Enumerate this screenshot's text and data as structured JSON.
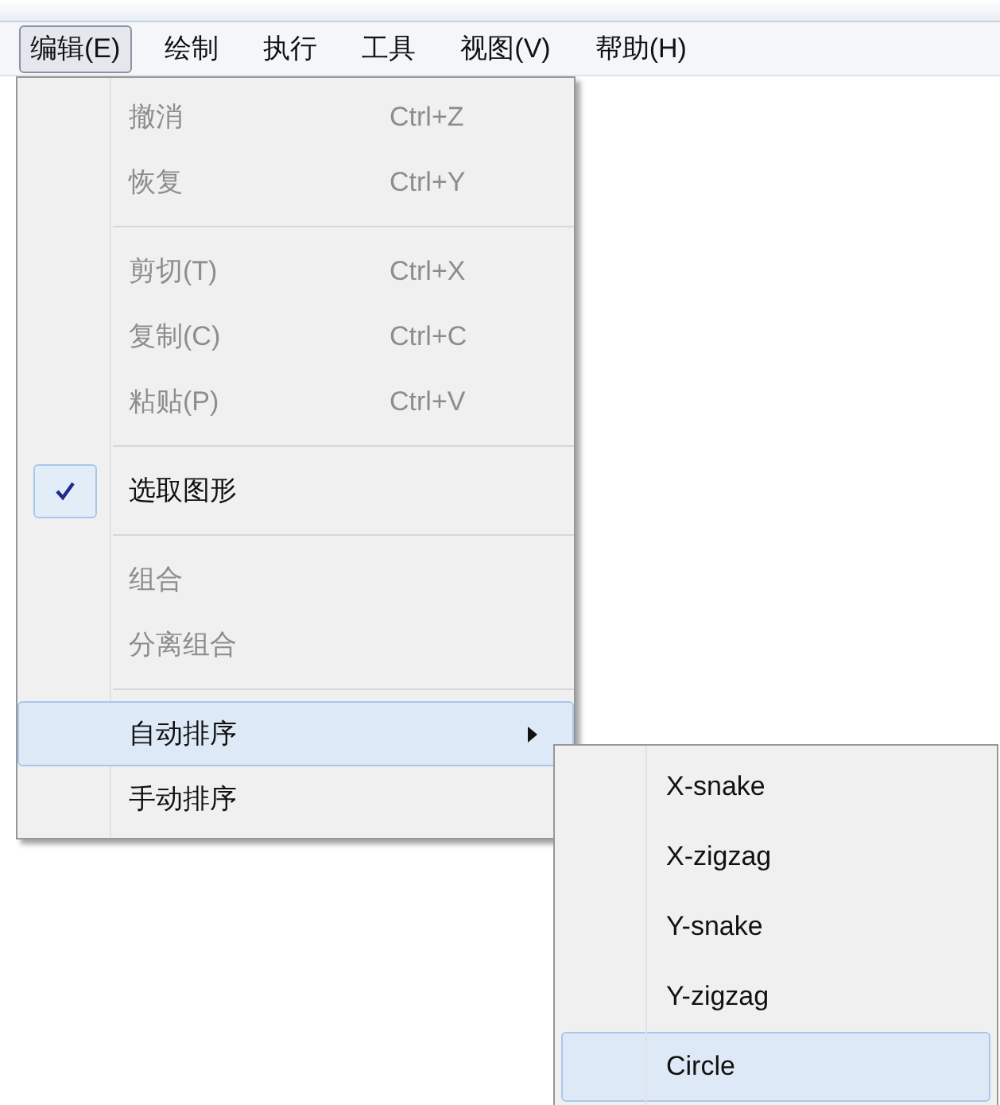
{
  "menubar": [
    {
      "label": "编辑(E)",
      "selected": true
    },
    {
      "label": "绘制",
      "selected": false
    },
    {
      "label": "执行",
      "selected": false
    },
    {
      "label": "工具",
      "selected": false
    },
    {
      "label": "视图(V)",
      "selected": false
    },
    {
      "label": "帮助(H)",
      "selected": false
    }
  ],
  "menu": [
    {
      "kind": "item",
      "label": "撤消",
      "shortcut": "Ctrl+Z",
      "disabled": true,
      "checked": false,
      "selected": false,
      "submenu": false
    },
    {
      "kind": "item",
      "label": "恢复",
      "shortcut": "Ctrl+Y",
      "disabled": true,
      "checked": false,
      "selected": false,
      "submenu": false
    },
    {
      "kind": "separator"
    },
    {
      "kind": "item",
      "label": "剪切(T)",
      "shortcut": "Ctrl+X",
      "disabled": true,
      "checked": false,
      "selected": false,
      "submenu": false
    },
    {
      "kind": "item",
      "label": "复制(C)",
      "shortcut": "Ctrl+C",
      "disabled": true,
      "checked": false,
      "selected": false,
      "submenu": false
    },
    {
      "kind": "item",
      "label": "粘贴(P)",
      "shortcut": "Ctrl+V",
      "disabled": true,
      "checked": false,
      "selected": false,
      "submenu": false
    },
    {
      "kind": "separator"
    },
    {
      "kind": "item",
      "label": "选取图形",
      "disabled": false,
      "checked": true,
      "selected": false,
      "submenu": false
    },
    {
      "kind": "separator"
    },
    {
      "kind": "item",
      "label": "组合",
      "disabled": true,
      "checked": false,
      "selected": false,
      "submenu": false
    },
    {
      "kind": "item",
      "label": "分离组合",
      "disabled": true,
      "checked": false,
      "selected": false,
      "submenu": false
    },
    {
      "kind": "separator"
    },
    {
      "kind": "item",
      "label": "自动排序",
      "disabled": false,
      "checked": false,
      "selected": true,
      "submenu": true
    },
    {
      "kind": "item",
      "label": "手动排序",
      "disabled": false,
      "checked": false,
      "selected": false,
      "submenu": false
    }
  ],
  "submenu": [
    {
      "label": "X-snake",
      "selected": false
    },
    {
      "label": "X-zigzag",
      "selected": false
    },
    {
      "label": "Y-snake",
      "selected": false
    },
    {
      "label": "Y-zigzag",
      "selected": false
    },
    {
      "label": "Circle",
      "selected": true
    }
  ]
}
